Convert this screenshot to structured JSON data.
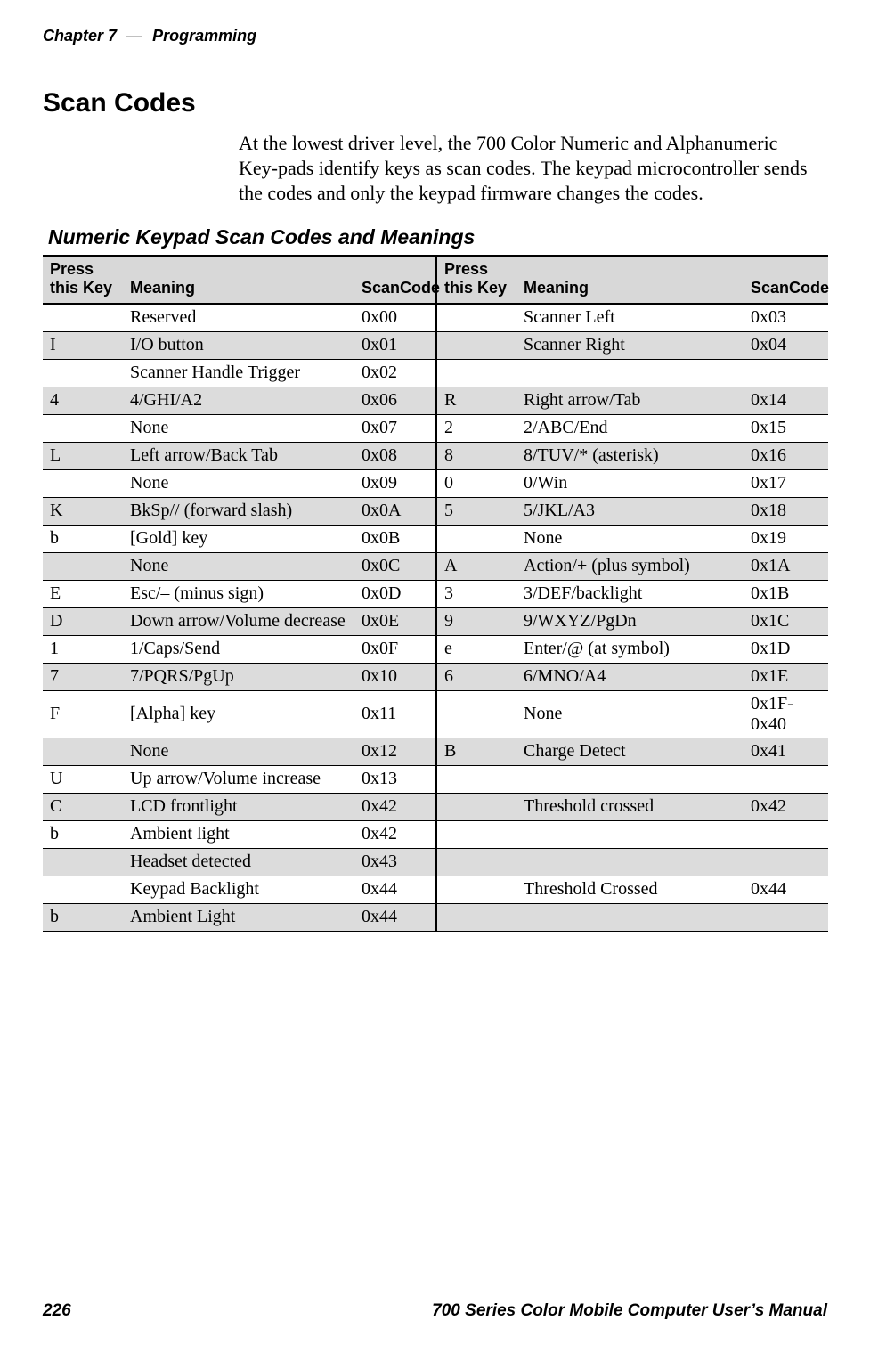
{
  "header": {
    "chapter": "Chapter 7",
    "sep": "—",
    "title": "Programming"
  },
  "section_heading": "Scan Codes",
  "body_paragraph": "At the lowest driver level, the 700 Color Numeric and Alphanumeric Key-pads identify keys as scan codes. The keypad microcontroller sends the codes and only the keypad firmware changes the codes.",
  "table_title": "Numeric Keypad Scan Codes and Meanings",
  "columns": {
    "key_l": "Press\nthis Key",
    "meaning_l": "Meaning",
    "code_l": "ScanCode",
    "key_r": "Press\nthis Key",
    "meaning_r": "Meaning",
    "code_r": "ScanCode"
  },
  "rows": [
    {
      "l": {
        "key": "",
        "meaning": "Reserved",
        "code": "0x00"
      },
      "r": {
        "key": "",
        "meaning": "Scanner Left",
        "code": "0x03"
      },
      "shade": false
    },
    {
      "l": {
        "key": "I",
        "meaning": "I/O button",
        "code": "0x01"
      },
      "r": {
        "key": "",
        "meaning": "Scanner Right",
        "code": "0x04"
      },
      "shade": true
    },
    {
      "l": {
        "key": "",
        "meaning": "Scanner Handle Trigger",
        "code": "0x02"
      },
      "r": {
        "key": "",
        "meaning": "",
        "code": ""
      },
      "shade": false
    },
    {
      "l": {
        "key": "4",
        "meaning": "4/GHI/A2",
        "code": "0x06"
      },
      "r": {
        "key": "R",
        "meaning": "Right arrow/Tab",
        "code": "0x14"
      },
      "shade": true
    },
    {
      "l": {
        "key": "",
        "meaning": "None",
        "code": "0x07"
      },
      "r": {
        "key": "2",
        "meaning": "2/ABC/End",
        "code": "0x15"
      },
      "shade": false
    },
    {
      "l": {
        "key": "L",
        "meaning": "Left arrow/Back Tab",
        "code": "0x08"
      },
      "r": {
        "key": "8",
        "meaning": "8/TUV/* (asterisk)",
        "code": "0x16"
      },
      "shade": true
    },
    {
      "l": {
        "key": "",
        "meaning": "None",
        "code": "0x09"
      },
      "r": {
        "key": "0",
        "meaning": "0/Win",
        "code": "0x17"
      },
      "shade": false
    },
    {
      "l": {
        "key": "K",
        "meaning": "BkSp// (forward slash)",
        "code": "0x0A"
      },
      "r": {
        "key": "5",
        "meaning": "5/JKL/A3",
        "code": "0x18"
      },
      "shade": true
    },
    {
      "l": {
        "key": "b",
        "meaning": "[Gold] key",
        "code": "0x0B"
      },
      "r": {
        "key": "",
        "meaning": "None",
        "code": "0x19"
      },
      "shade": false
    },
    {
      "l": {
        "key": "",
        "meaning": "None",
        "code": "0x0C"
      },
      "r": {
        "key": "A",
        "meaning": "Action/+ (plus symbol)",
        "code": "0x1A"
      },
      "shade": true
    },
    {
      "l": {
        "key": "E",
        "meaning": "Esc/– (minus sign)",
        "code": "0x0D"
      },
      "r": {
        "key": "3",
        "meaning": "3/DEF/backlight",
        "code": "0x1B"
      },
      "shade": false
    },
    {
      "l": {
        "key": "D",
        "meaning": "Down arrow/Volume decrease",
        "code": "0x0E"
      },
      "r": {
        "key": "9",
        "meaning": "9/WXYZ/PgDn",
        "code": "0x1C"
      },
      "shade": true
    },
    {
      "l": {
        "key": "1",
        "meaning": "1/Caps/Send",
        "code": "0x0F"
      },
      "r": {
        "key": "e",
        "meaning": "Enter/@ (at symbol)",
        "code": "0x1D"
      },
      "shade": false
    },
    {
      "l": {
        "key": "7",
        "meaning": "7/PQRS/PgUp",
        "code": "0x10"
      },
      "r": {
        "key": "6",
        "meaning": "6/MNO/A4",
        "code": "0x1E"
      },
      "shade": true
    },
    {
      "l": {
        "key": "F",
        "meaning": "[Alpha] key",
        "code": "0x11"
      },
      "r": {
        "key": "",
        "meaning": "None",
        "code": "0x1F-0x40"
      },
      "shade": false
    },
    {
      "l": {
        "key": "",
        "meaning": "None",
        "code": "0x12"
      },
      "r": {
        "key": "B",
        "meaning": "Charge Detect",
        "code": "0x41"
      },
      "shade": true
    },
    {
      "l": {
        "key": "U",
        "meaning": "Up arrow/Volume increase",
        "code": "0x13"
      },
      "r": {
        "key": "",
        "meaning": "",
        "code": ""
      },
      "shade": false
    },
    {
      "l": {
        "key": "C",
        "meaning": "LCD frontlight",
        "code": "0x42"
      },
      "r": {
        "key": "",
        "meaning": "Threshold crossed",
        "code": "0x42"
      },
      "shade": true
    },
    {
      "l": {
        "key": "b",
        "meaning": "Ambient light",
        "code": "0x42"
      },
      "r": {
        "key": "",
        "meaning": "",
        "code": ""
      },
      "shade": false
    },
    {
      "l": {
        "key": "",
        "meaning": "Headset detected",
        "code": "0x43"
      },
      "r": {
        "key": "",
        "meaning": "",
        "code": ""
      },
      "shade": true,
      "right_shade_only": true
    },
    {
      "l": {
        "key": "",
        "meaning": "Keypad Backlight",
        "code": "0x44"
      },
      "r": {
        "key": "",
        "meaning": "Threshold Crossed",
        "code": "0x44"
      },
      "shade": false
    },
    {
      "l": {
        "key": "b",
        "meaning": "Ambient Light",
        "code": "0x44"
      },
      "r": {
        "key": "",
        "meaning": "",
        "code": ""
      },
      "shade": true,
      "right_shade_only": true
    }
  ],
  "footer": {
    "page": "226",
    "manual": "700 Series Color Mobile Computer User’s Manual"
  }
}
